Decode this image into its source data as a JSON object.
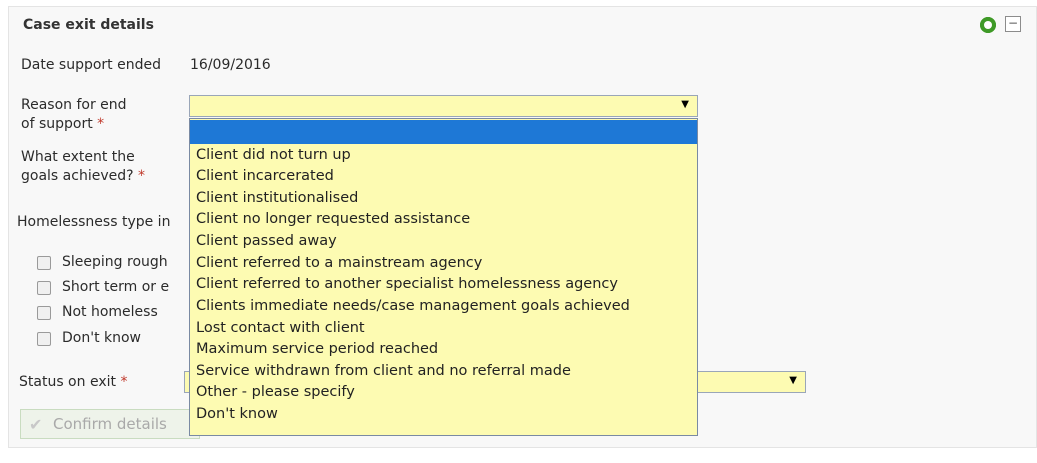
{
  "panel": {
    "title": "Case exit details"
  },
  "date_support_ended": {
    "label": "Date support ended",
    "value": "16/09/2016"
  },
  "reason": {
    "label_line1": "Reason for end",
    "label_line2": "of support",
    "required": "*",
    "selected": ""
  },
  "goals": {
    "label_line1": "What extent the",
    "label_line2": "goals achieved?",
    "required": "*"
  },
  "homelessness": {
    "label": "Homelessness type in",
    "options": [
      "Sleeping rough",
      "Short term or e",
      "Not homeless",
      "Don't know"
    ]
  },
  "status_on_exit": {
    "label": "Status on exit",
    "required": "*",
    "selected": ""
  },
  "confirm_button": {
    "label": "Confirm details"
  },
  "dropdown_options": [
    "",
    "Client did not turn up",
    "Client incarcerated",
    "Client institutionalised",
    "Client no longer requested assistance",
    "Client passed away",
    "Client referred to a mainstream agency",
    "Client referred to another specialist homelessness agency",
    "Clients immediate needs/case management goals achieved",
    "Lost contact with client",
    "Maximum service period reached",
    "Service withdrawn from client and no referral made",
    "Other - please specify",
    "Don't know"
  ],
  "colors": {
    "field_bg": "#fdfbb2",
    "highlight": "#1e78d6",
    "status_green": "#3f9a27"
  }
}
